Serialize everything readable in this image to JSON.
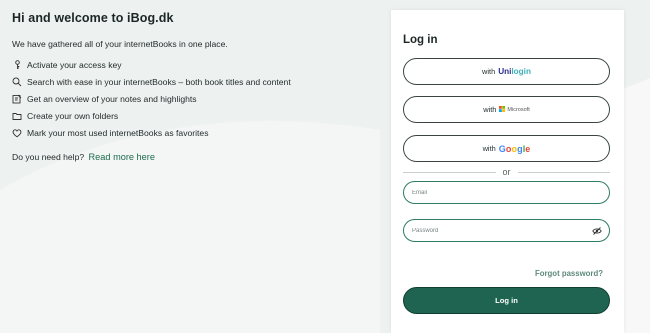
{
  "welcome": {
    "title": "Hi and welcome to iBog.dk",
    "intro": "We have gathered all of your internetBooks in one place.",
    "features": [
      {
        "icon": "key-person-icon",
        "label": "Activate your access key"
      },
      {
        "icon": "search-icon",
        "label": "Search with ease in your internetBooks – both book titles and content"
      },
      {
        "icon": "notes-icon",
        "label": "Get an overview of your notes and highlights"
      },
      {
        "icon": "folder-icon",
        "label": "Create your own folders"
      },
      {
        "icon": "heart-icon",
        "label": "Mark your most used internetBooks as favorites"
      }
    ],
    "help_text": "Do you need help?",
    "help_link": "Read more here"
  },
  "login": {
    "title": "Log in",
    "with": "with",
    "unilogin_brand_prefix": "Uni",
    "unilogin_brand_suffix": "login",
    "microsoft_brand": "Microsoft",
    "google_brand": "Google",
    "or": "or",
    "email_placeholder": "Email",
    "password_placeholder": "Password",
    "forgot": "Forgot password?",
    "submit": "Log in"
  },
  "colors": {
    "accent": "#1e6450",
    "link": "#1e6b4f",
    "field_border": "#2e7d5f",
    "background": "#edf1ef"
  }
}
